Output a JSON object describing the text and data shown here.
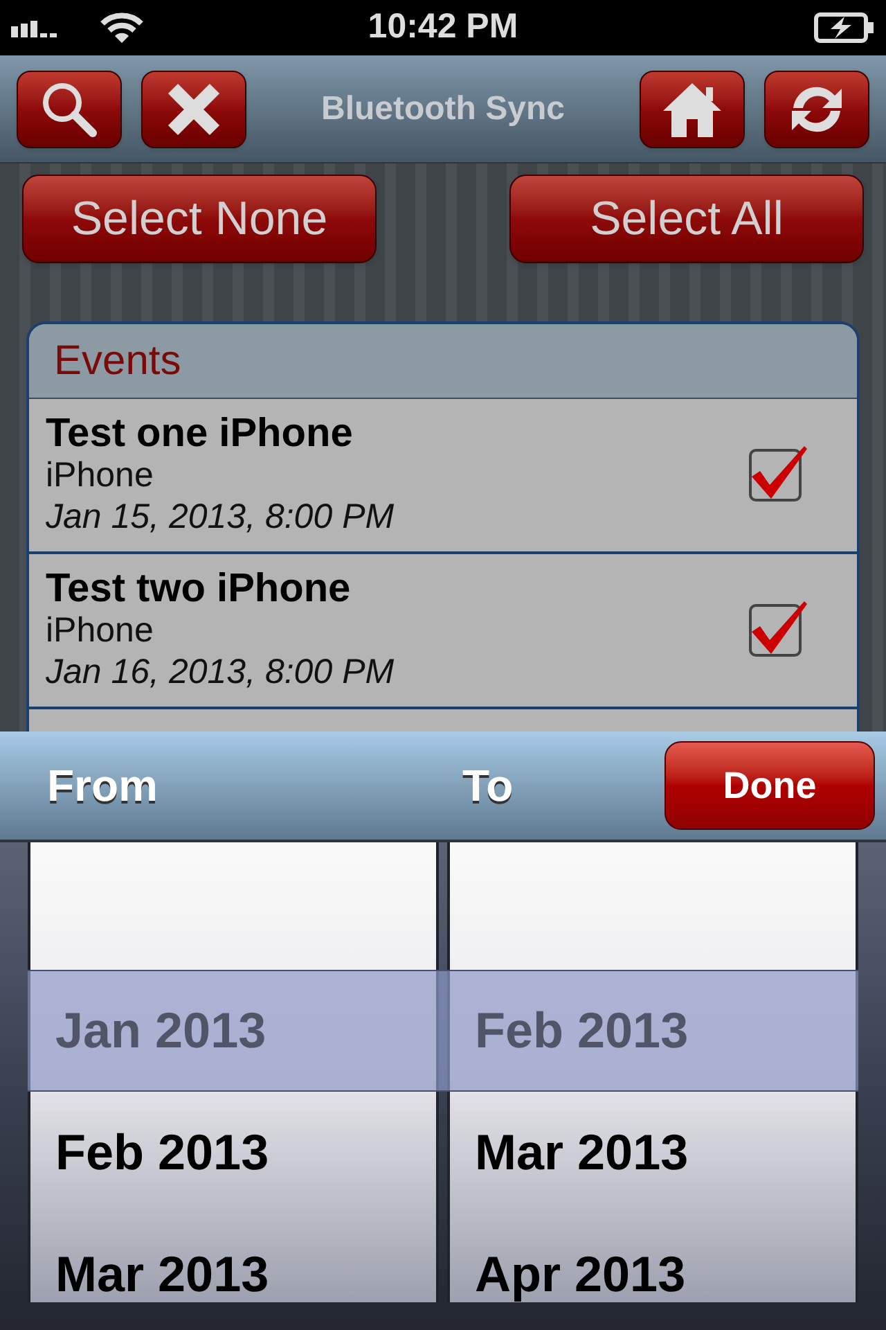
{
  "status_bar": {
    "time": "10:42 PM"
  },
  "nav_bar": {
    "title": "Bluetooth Sync"
  },
  "select_buttons": [
    {
      "label": "Select None"
    },
    {
      "label": "Select All"
    }
  ],
  "events": {
    "header": "Events",
    "items": [
      {
        "title": "Test one iPhone",
        "calendar": "iPhone",
        "date": "Jan 15, 2013, 8:00 PM",
        "checked": true
      },
      {
        "title": "Test two iPhone",
        "calendar": "iPhone",
        "date": "Jan 16, 2013, 8:00 PM",
        "checked": true
      }
    ]
  },
  "picker_toolbar": {
    "from_label": "From",
    "to_label": "To",
    "done_button": "Done"
  },
  "picker": {
    "columns": [
      {
        "rows": [
          {
            "label": "Jan 2013",
            "selected": true
          },
          {
            "label": "Feb 2013",
            "selected": false
          },
          {
            "label": "Mar 2013",
            "selected": false
          }
        ]
      },
      {
        "rows": [
          {
            "label": "Feb 2013",
            "selected": true
          },
          {
            "label": "Mar 2013",
            "selected": false
          },
          {
            "label": "Apr 2013",
            "selected": false
          }
        ]
      }
    ]
  }
}
